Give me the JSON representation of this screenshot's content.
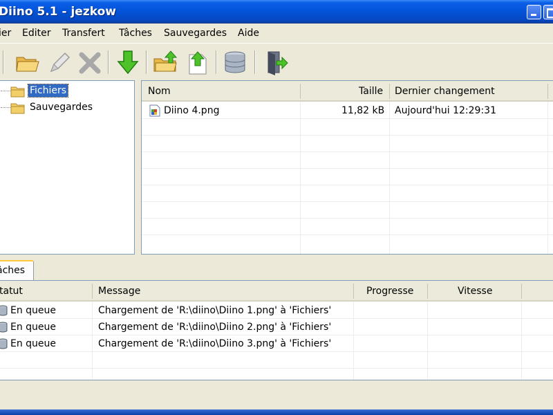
{
  "window": {
    "title": "Diino 5.1 - jezkow"
  },
  "menu": [
    "ier",
    "Editer",
    "Transfert",
    "Tâches",
    "Sauvegardes",
    "Aide"
  ],
  "toolbar": {
    "icons": [
      "open-folder-icon",
      "pencil-icon",
      "delete-icon",
      "download-icon",
      "upload-folder-icon",
      "upload-file-icon",
      "database-icon",
      "exit-icon"
    ]
  },
  "tree": {
    "items": [
      {
        "label": "Fichiers",
        "selected": true
      },
      {
        "label": "Sauvegardes",
        "selected": false
      }
    ]
  },
  "files": {
    "columns": [
      "Nom",
      "Taille",
      "Dernier changement"
    ],
    "rows": [
      {
        "name": "Diino 4.png",
        "size": "11,82 kB",
        "changed": "Aujourd'hui 12:29:31"
      }
    ]
  },
  "tabs": {
    "tasks_label": "âches"
  },
  "tasks": {
    "columns": [
      "tatut",
      "Message",
      "Progresse",
      "Vitesse"
    ],
    "rows": [
      {
        "status": "En queue",
        "message": "Chargement de 'R:\\diino\\Diino 1.png' à 'Fichiers'"
      },
      {
        "status": "En queue",
        "message": "Chargement de 'R:\\diino\\Diino 2.png' à 'Fichiers'"
      },
      {
        "status": "En queue",
        "message": "Chargement de 'R:\\diino\\Diino 3.png' à 'Fichiers'"
      }
    ]
  }
}
